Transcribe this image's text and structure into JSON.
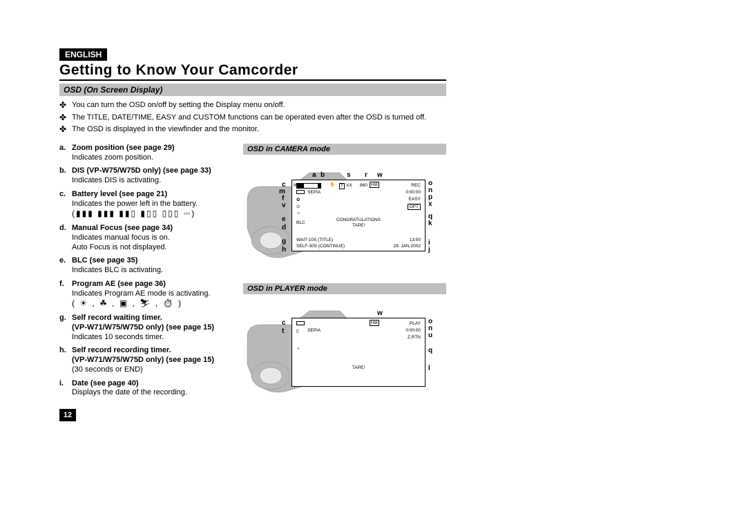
{
  "language_badge": "ENGLISH",
  "page_title": "Getting to Know Your Camcorder",
  "section_title": "OSD (On Screen Display)",
  "bullets": [
    "You can turn the OSD on/off by setting the Display menu on/off.",
    "The TITLE, DATE/TIME, EASY and CUSTOM functions can be operated even after the OSD is turned off.",
    "The OSD is displayed in the viewfinder and the monitor."
  ],
  "definitions": [
    {
      "label": "a.",
      "title": "Zoom position (see page 29)",
      "desc": "Indicates zoom position."
    },
    {
      "label": "b.",
      "title": "DIS (VP-W75/W75D only) (see page 33)",
      "desc": "Indicates DIS is activating."
    },
    {
      "label": "c.",
      "title": "Battery level (see page 21)",
      "desc": "Indicates the power left in the battery.",
      "icons": "(▮▮▮ ▮▮▮ ▮▮▯ ▮▯▯ ▯▯▯ ⎓)"
    },
    {
      "label": "d.",
      "title": "Manual Focus (see page 34)",
      "desc": "Indicates manual focus is on.\nAuto Focus is not displayed."
    },
    {
      "label": "e.",
      "title": "BLC (see page 35)",
      "desc": "Indicates BLC is activating."
    },
    {
      "label": "f.",
      "title": "Program AE (see page 36)",
      "desc": "Indicates Program AE mode is activating.",
      "icons": "( ☀ , ☘ , ▣ , ⛷ , ⏱ )"
    },
    {
      "label": "g.",
      "title": "Self record waiting timer.\n(VP-W71/W75/W75D only) (see page 15)",
      "desc": "Indicates 10 seconds timer."
    },
    {
      "label": "h.",
      "title": "Self record recording timer.\n(VP-W71/W75/W75D only) (see page 15)",
      "desc": "(30 seconds or END)"
    },
    {
      "label": "i.",
      "title": "Date (see page 40)",
      "desc": "Displays the date of the recording."
    }
  ],
  "mode_camera_title": "OSD in CAMERA mode",
  "mode_player_title": "OSD in PLAYER mode",
  "camera_callouts_top": [
    "a",
    "b",
    "s",
    "r",
    "w"
  ],
  "camera_callouts_left": [
    "c",
    "m",
    "f",
    "v",
    "e",
    "d",
    "g",
    "h"
  ],
  "camera_callouts_right": [
    "o",
    "n",
    "p",
    "x",
    "q",
    "k",
    "i",
    "j"
  ],
  "player_callouts_top": [
    "w"
  ],
  "player_callouts_left": [
    "c",
    "t"
  ],
  "player_callouts_right": [
    "o",
    "n",
    "u",
    "q",
    "l"
  ],
  "osd_camera_values": {
    "zoom_bar_label_w": "W",
    "zoom_bar_label_t": "T",
    "zoom_x": "XX",
    "speed_860": "860",
    "rec": "REC",
    "timecode": "0:00:00",
    "easy": "EASY",
    "dse": "SEPIA",
    "light": "☼",
    "mf": "⊙",
    "blc": "BLC",
    "title": "CONGRATULATIONS",
    "tape": "TAPE!",
    "wait": "WAIT-10S (TITLE)",
    "self": "SELF-30S (CONTINUE)",
    "time": "13:00",
    "date": "29. JAN.2002",
    "ae": "✿",
    "dis": "✋",
    "hi8": "Hi8",
    "opt": "OPT"
  },
  "osd_player_values": {
    "hi8": "Hi8",
    "play": "PLAY",
    "timecode": "0:00:00",
    "zrtn": "Z.RTN",
    "sepia": "SEPIA",
    "tape": "TAPE!",
    "light": "☼"
  },
  "page_number": "12"
}
